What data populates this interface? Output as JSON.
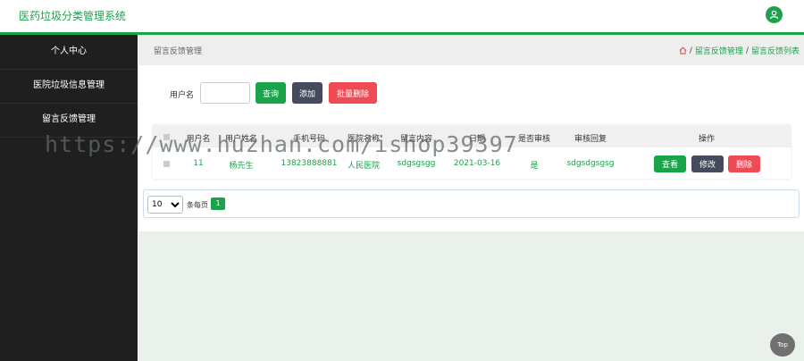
{
  "app": {
    "title": "医药垃圾分类管理系统"
  },
  "sidebar": {
    "items": [
      {
        "label": "个人中心"
      },
      {
        "label": "医院垃圾信息管理"
      },
      {
        "label": "留言反馈管理"
      }
    ]
  },
  "breadcrumb": {
    "page_title": "留言反馈管理",
    "path1": "留言反馈管理",
    "path2": "留言反馈列表",
    "sep": "/"
  },
  "search": {
    "label": "用户名",
    "value": "",
    "placeholder": ""
  },
  "toolbar": {
    "query": "查询",
    "add": "添加",
    "batch_delete": "批量删除"
  },
  "table": {
    "columns": [
      "用户名",
      "用户姓名",
      "手机号码",
      "医院名称",
      "留言内容",
      "日期",
      "是否审核",
      "审核回复",
      "操作"
    ],
    "rows": [
      {
        "username": "11",
        "name": "杨先生",
        "phone": "13823888881",
        "hospital": "人民医院",
        "message": "sdgsgsgg",
        "date": "2021-03-16",
        "approved": "是",
        "reply": "sdgsdgsgsg"
      }
    ],
    "actions": {
      "view": "查看",
      "edit": "修改",
      "delete": "删除"
    }
  },
  "pager": {
    "page_size": "10",
    "per_page_label": "条每页",
    "current_page": "1"
  },
  "watermark": "https://www.huzhan.com/ishop39397",
  "top_button": "Top",
  "colors": {
    "brand": "#1aa34a",
    "danger": "#ef4b55",
    "dark": "#454a5c",
    "sidebar": "#1f1f1f"
  }
}
